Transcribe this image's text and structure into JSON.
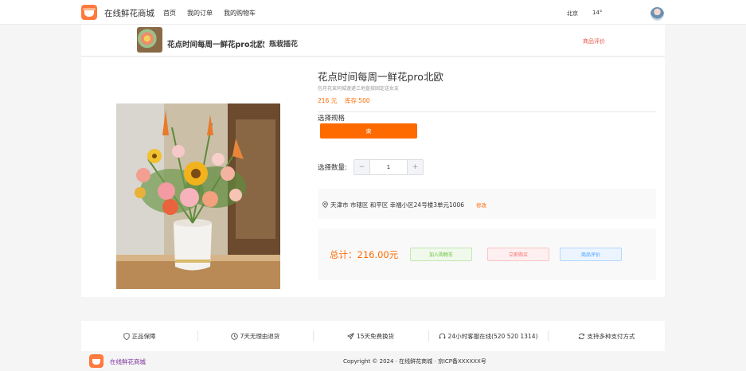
{
  "topbar": {
    "brand": "在线鲜花商城",
    "nav": [
      "首页",
      "我的订单",
      "我的购物车"
    ],
    "city": "北京",
    "temperature": "14°"
  },
  "subheader": {
    "title": "花点时间每周一鲜花pro北欧",
    "category": "瓶栽插花",
    "review_link": "商品评价"
  },
  "product": {
    "title": "花点时间每周一鲜花pro北欧",
    "description": "包月花束同城速递三地直接固定送女友",
    "price": "216 元",
    "stock": "库存 500",
    "spec_label": "选择规格",
    "spec_option": "束",
    "quantity_label": "选择数量:",
    "quantity": "1",
    "minus": "−",
    "plus": "+"
  },
  "address": {
    "text": "天津市 市辖区 和平区 幸福小区24号楼3单元1006",
    "edit": "修改"
  },
  "order": {
    "total": "总计：216.00元",
    "add_cart": "加入购物车",
    "buy_now": "立即购买",
    "review": "商品评价"
  },
  "features": [
    {
      "label": "正品保障",
      "icon": "shield-icon"
    },
    {
      "label": "7天无理由退货",
      "icon": "clock-icon"
    },
    {
      "label": "15天免费换货",
      "icon": "send-icon"
    },
    {
      "label": "24小时客服在线(520 520 1314)",
      "icon": "headset-icon"
    },
    {
      "label": "支持多种支付方式",
      "icon": "refresh-icon"
    }
  ],
  "footer": {
    "brand": "在线鲜花商城",
    "copyright": "Copyright © 2024 · 在线鲜花商城 · 京ICP备XXXXXX号"
  },
  "colors": {
    "accent": "#ff6a00",
    "logo": "#ff7a3d"
  }
}
